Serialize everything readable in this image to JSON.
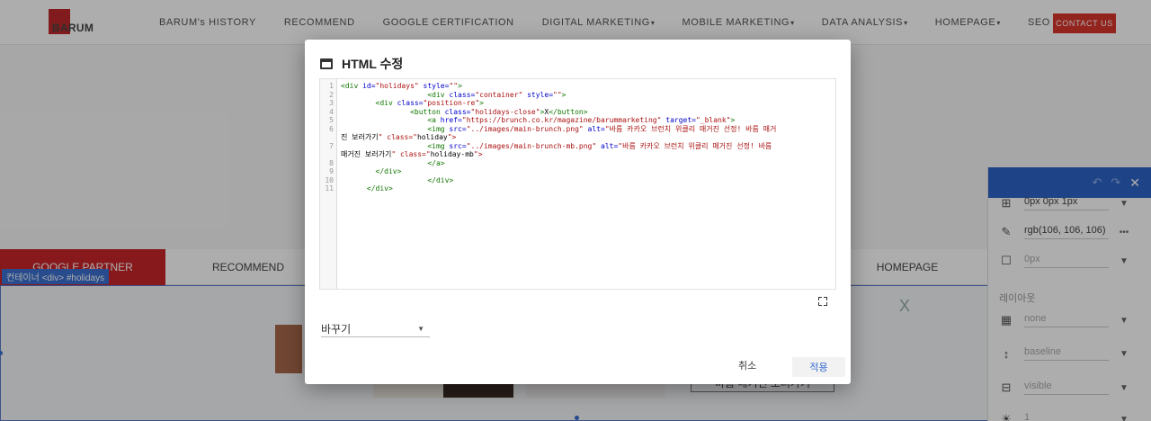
{
  "site": {
    "logo_text": "BARUM",
    "nav": [
      {
        "label": "BARUM's HISTORY",
        "caret": ""
      },
      {
        "label": "RECOMMEND",
        "caret": ""
      },
      {
        "label": "GOOGLE CERTIFICATION",
        "caret": ""
      },
      {
        "label": "DIGITAL MARKETING",
        "caret": "▾"
      },
      {
        "label": "MOBILE MARKETING",
        "caret": "▾"
      },
      {
        "label": "DATA ANALYSIS",
        "caret": "▾"
      },
      {
        "label": "HOMEPAGE",
        "caret": "▾"
      },
      {
        "label": "SEO MARKETING",
        "caret": ""
      }
    ],
    "contact_label": "CONTACT US",
    "tabs": [
      "GOOGLE PARTNER",
      "RECOMMEND",
      "HOMEPAGE"
    ],
    "selection_label": "컨테이너 <div> #holidays",
    "holiday_close": "X",
    "banner_text": "바름 매거진 보러가기"
  },
  "style_panel": {
    "rows": [
      {
        "icon": "border-icon",
        "glyph": "⊞",
        "value": "0px 0px 1px"
      },
      {
        "icon": "pen-icon",
        "glyph": "✎",
        "value": "rgb(106, 106, 106) r"
      },
      {
        "icon": "square-icon",
        "glyph": "☐",
        "value": "0px"
      },
      {
        "icon": "background-image-icon",
        "glyph": "▦",
        "value": "none"
      },
      {
        "icon": "vertical-align-icon",
        "glyph": "↕",
        "value": "baseline"
      },
      {
        "icon": "overflow-icon",
        "glyph": "⊟",
        "value": "visible"
      },
      {
        "icon": "brightness-icon",
        "glyph": "☀",
        "value": "1"
      }
    ],
    "section_layout": "레이아웃",
    "undo": "↶",
    "redo": "↷",
    "close": "✕"
  },
  "dialog": {
    "title": "HTML 수정",
    "replace_label": "바꾸기",
    "cancel_label": "취소",
    "apply_label": "적용",
    "line_numbers": [
      "1",
      "2",
      "3",
      "4",
      "5",
      "6",
      "",
      "7",
      "",
      "8",
      "9",
      "10",
      "11"
    ],
    "code_lines": [
      "<div id=\"holidays\" style=\"\">",
      "                    <div class=\"container\" style=\"\">",
      "        <div class=\"position-re\">",
      "                <button class=\"holidays-close\">X</button>",
      "                    <a href=\"https://brunch.co.kr/magazine/barummarketing\" target=\"_blank\">",
      "                    <img src=\"../images/main-brunch.png\" alt=\"바름 카카오 브런치 위클리 매거진 선정! 바름 매거",
      "진 보러가기\" class=\"holiday\">",
      "                    <img src=\"../images/main-brunch-mb.png\" alt=\"바름 카카오 브런치 위클리 매거진 선정! 바름",
      "매거진 보러가기\" class=\"holiday-mb\">",
      "                    </a>",
      "        </div>",
      "                    </div>",
      "      </div>"
    ]
  },
  "colors": {
    "brand_red": "#c8262a",
    "accent_blue": "#2f64c7"
  }
}
